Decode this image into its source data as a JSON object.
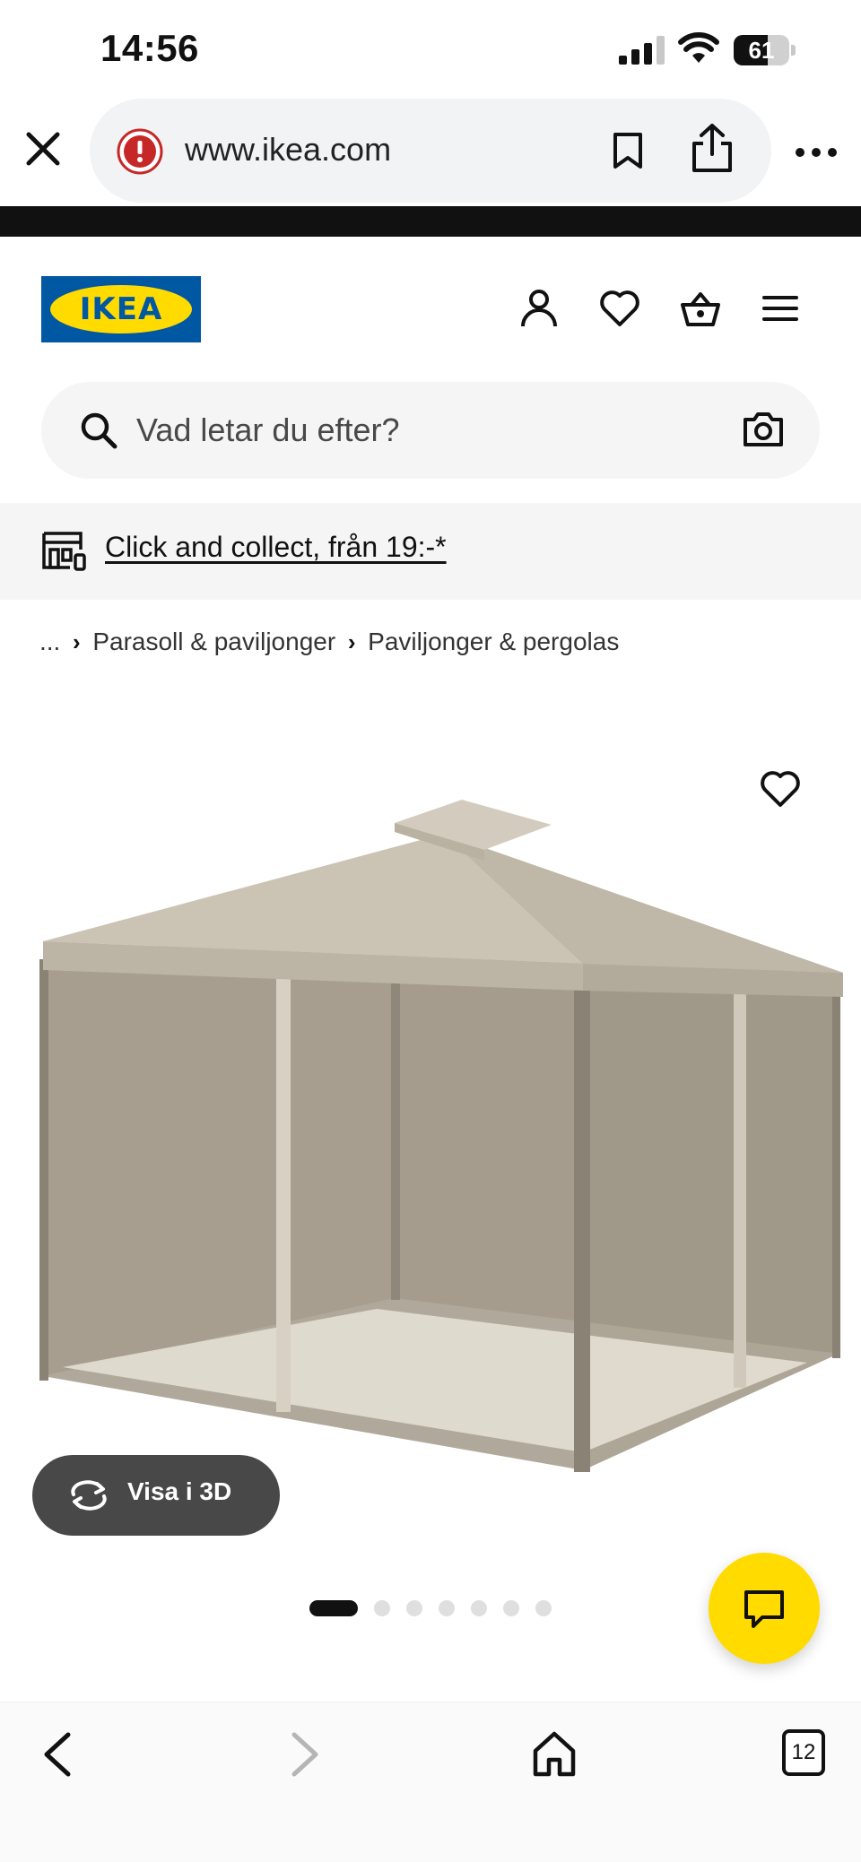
{
  "status_bar": {
    "time": "14:56",
    "battery_level": "61",
    "battery_fraction": 0.61
  },
  "browser": {
    "url": "www.ikea.com",
    "close_icon": "close-icon",
    "security_icon": "warning-icon",
    "bookmark_icon": "bookmark-icon",
    "share_icon": "share-icon",
    "more_icon": "more-icon"
  },
  "header": {
    "logo_text": "IKEA",
    "brand_blue": "#0058a3",
    "brand_yellow": "#ffdb00",
    "icons": [
      "account-icon",
      "heart-icon",
      "basket-icon",
      "menu-icon"
    ]
  },
  "search": {
    "placeholder": "Vad letar du efter?",
    "value": ""
  },
  "promo": {
    "label": "Click and collect, från 19:-*"
  },
  "breadcrumb": {
    "items": [
      "...",
      "Parasoll & paviljonger",
      "Paviljonger & pergolas"
    ]
  },
  "product": {
    "view_3d_label": "Visa i 3D",
    "carousel_total": 7,
    "carousel_active": 1
  },
  "bottom_bar": {
    "tab_count": "12"
  }
}
